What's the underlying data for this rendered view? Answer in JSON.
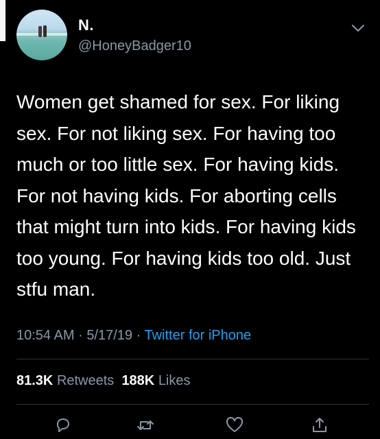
{
  "tweet": {
    "author_name": "N.",
    "author_handle": "@HoneyBadger10",
    "text": "Women get shamed for sex. For liking sex. For not liking sex. For having too much or too little sex. For having kids. For not having kids. For aborting cells that might turn into kids. For having kids too young. For having kids too old. Just stfu man.",
    "time": "10:54 AM",
    "date": "5/17/19",
    "source": "Twitter for iPhone",
    "separator": "·"
  },
  "stats": {
    "retweets_count": "81.3K",
    "retweets_label": "Retweets",
    "likes_count": "188K",
    "likes_label": "Likes"
  },
  "icons": {
    "menu": "chevron-down-icon",
    "reply": "reply-icon",
    "retweet": "retweet-icon",
    "like": "heart-icon",
    "share": "share-icon"
  },
  "colors": {
    "background": "#000000",
    "text": "#ffffff",
    "secondary": "#8899a6",
    "link": "#1da1f2"
  }
}
